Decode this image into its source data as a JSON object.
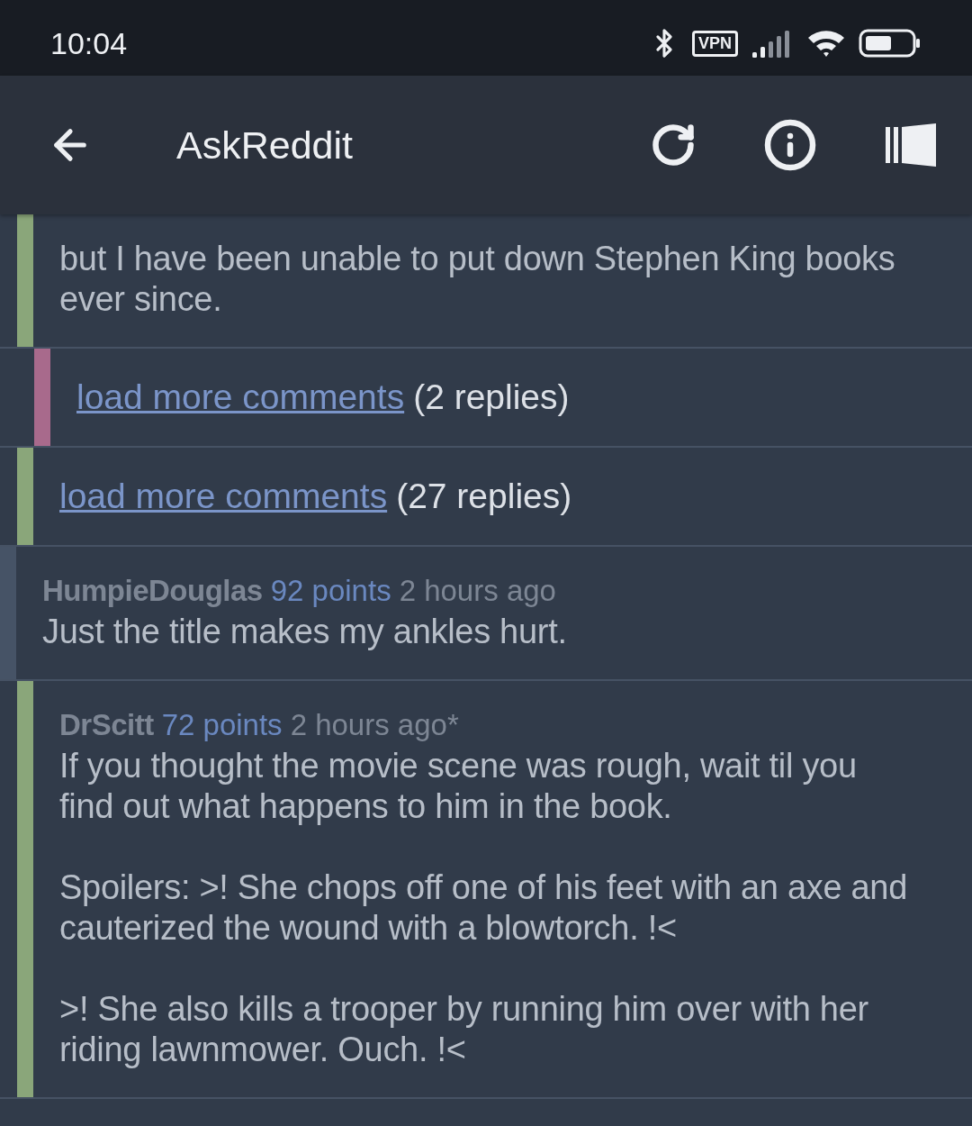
{
  "status_bar": {
    "time": "10:04",
    "vpn_badge": "VPN"
  },
  "toolbar": {
    "title": "AskReddit"
  },
  "comments": [
    {
      "kind": "continued",
      "children": [
        {
          "kind": "comment",
          "body": [
            "but I have been unable to put down Stephen King books ever since."
          ],
          "children": [
            {
              "kind": "load_more",
              "link": "load more comments",
              "count": "(2 replies)"
            }
          ]
        },
        {
          "kind": "load_more",
          "link": "load more comments",
          "count": "(27 replies)"
        }
      ]
    },
    {
      "kind": "comment",
      "author": "HumpieDouglas",
      "points": "92 points",
      "time": "2 hours ago",
      "body": [
        "Just the title makes my ankles hurt."
      ],
      "children": [
        {
          "kind": "comment",
          "author": "DrScitt",
          "points": "72 points",
          "time": "2 hours ago*",
          "body": [
            "If you thought the movie scene was rough, wait til you find out what happens to him in the book.",
            "Spoilers: >! She chops off one of his feet with an axe and cauterized the wound with a blowtorch. !<",
            ">! She also kills a trooper by running him over with her riding lawnmower. Ouch. !<"
          ]
        }
      ]
    }
  ]
}
